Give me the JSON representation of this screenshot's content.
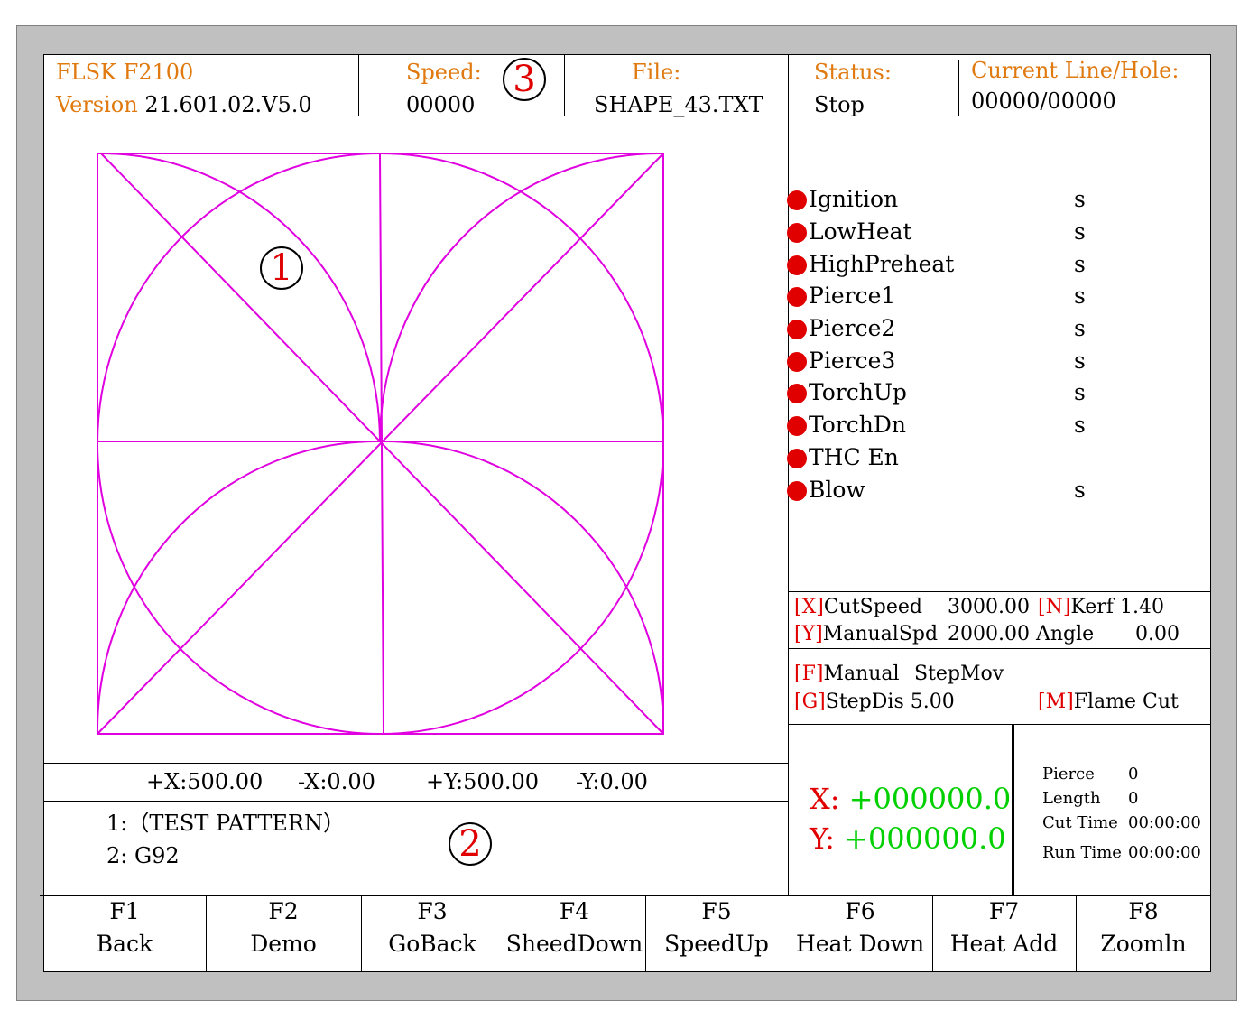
{
  "header": {
    "model": "FLSK F2100",
    "version_label": "Version",
    "version_value": "21.601.02.V5.0",
    "speed_label": "Speed:",
    "speed_value": "00000",
    "file_label": "File:",
    "file_value": "SHAPE_43.TXT",
    "status_label": "Status:",
    "status_value": "Stop",
    "line_label": "Current Line/Hole:",
    "line_value": "00000/00000"
  },
  "markers": {
    "m1": "1",
    "m2": "2",
    "m3": "3"
  },
  "colors": {
    "orange": "#e07a10",
    "shape": "#e000e0",
    "red": "#e00000",
    "green": "#00d000"
  },
  "io_items": [
    {
      "name": "Ignition",
      "unit": "s"
    },
    {
      "name": "LowHeat",
      "unit": "s"
    },
    {
      "name": "HighPreheat",
      "unit": "s"
    },
    {
      "name": "Pierce1",
      "unit": "s"
    },
    {
      "name": "Pierce2",
      "unit": "s"
    },
    {
      "name": "Pierce3",
      "unit": "s"
    },
    {
      "name": "TorchUp",
      "unit": "s"
    },
    {
      "name": "TorchDn",
      "unit": "s"
    },
    {
      "name": "THC En",
      "unit": ""
    },
    {
      "name": "Blow",
      "unit": "s"
    }
  ],
  "params": {
    "cutspeed_key": "[X]",
    "cutspeed_label": "CutSpeed",
    "cutspeed_value": "3000.00",
    "kerf_key": "[N]",
    "kerf_label": "Kerf",
    "kerf_value": "1.40",
    "manualspd_key": "[Y]",
    "manualspd_label": "ManualSpd",
    "manualspd_value": "2000.00",
    "angle_label": "Angle",
    "angle_value": "0.00",
    "manual_key": "[F]",
    "manual_label": "Manual",
    "manual_mode": "StepMov",
    "stepdis_key": "[G]",
    "stepdis_label": "StepDis",
    "stepdis_value": "5.00",
    "cut_key": "[M]",
    "cut_mode": "Flame Cut"
  },
  "range": {
    "xpos": "+X:500.00",
    "xneg": "-X:0.00",
    "ypos": "+Y:500.00",
    "yneg": "-Y:0.00"
  },
  "program": {
    "line1": "1:（TEST PATTERN）",
    "line2": "2: G92"
  },
  "coords": {
    "x_label": "X:",
    "x_value": "+000000.0",
    "y_label": "Y:",
    "y_value": "+000000.0"
  },
  "stats": {
    "pierce_label": "Pierce",
    "pierce_value": "0",
    "length_label": "Length",
    "length_value": "0",
    "cut_time_label": "Cut Time",
    "cut_time_value": "00:00:00",
    "run_time_label": "Run Time",
    "run_time_value": "00:00:00"
  },
  "fkeys": [
    {
      "key": "F1",
      "label": "Back"
    },
    {
      "key": "F2",
      "label": "Demo"
    },
    {
      "key": "F3",
      "label": "GoBack"
    },
    {
      "key": "F4",
      "label": "SheedDown"
    },
    {
      "key": "F5",
      "label": "SpeedUp"
    },
    {
      "key": "F6",
      "label": "Heat Down"
    },
    {
      "key": "F7",
      "label": "Heat Add"
    },
    {
      "key": "F8",
      "label": "Zoomln"
    }
  ]
}
